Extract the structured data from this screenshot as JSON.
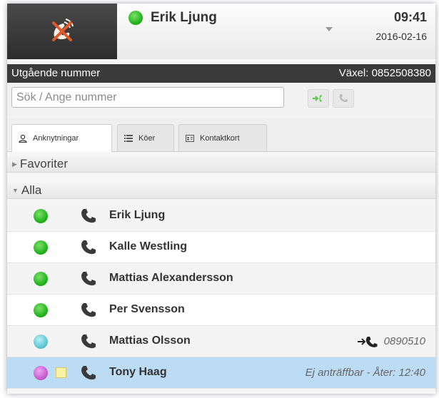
{
  "header": {
    "logo_icon": "no-call-phone-icon",
    "user_name": "Erik Ljung",
    "user_status_color": "#25b51e",
    "time": "09:41",
    "date": "2016-02-16"
  },
  "bar": {
    "left": "Utgående nummer",
    "right": "Växel: 0852508380"
  },
  "search": {
    "placeholder": "Sök / Ange nummer",
    "value": ""
  },
  "tabs": [
    {
      "label": "Anknytningar",
      "icon": "person-icon",
      "active": true
    },
    {
      "label": "Köer",
      "icon": "list-icon",
      "active": false
    },
    {
      "label": "Kontaktkort",
      "icon": "contact-card-icon",
      "active": false
    }
  ],
  "sections": {
    "favorites": "Favoriter",
    "all": "Alla"
  },
  "contacts": [
    {
      "name": "Erik Ljung",
      "status": "green",
      "right": ""
    },
    {
      "name": "Kalle Westling",
      "status": "green",
      "right": ""
    },
    {
      "name": "Mattias Alexandersson",
      "status": "green",
      "right": ""
    },
    {
      "name": "Per Svensson",
      "status": "green",
      "right": ""
    },
    {
      "name": "Mattias Olsson",
      "status": "cyan",
      "right": "0890510"
    },
    {
      "name": "Tony Haag",
      "status": "purple",
      "right": "Ej anträffbar - Åter: 12:40"
    }
  ],
  "colors": {
    "accent_green": "#25b51e",
    "selected_row": "#bcdcf6",
    "dark_bar": "#3a3a3a"
  }
}
